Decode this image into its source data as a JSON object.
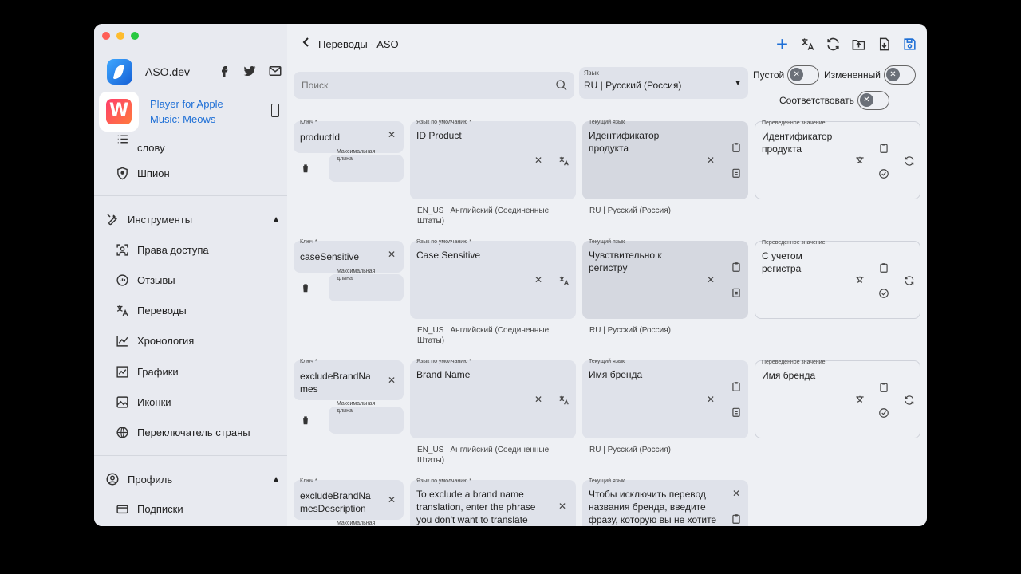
{
  "sidebar": {
    "brand": "ASO.dev",
    "app_title": "Player for Apple Music: Meows",
    "partial_item": "слову",
    "spy": "Шпион",
    "tools_section": "Инструменты",
    "tools_items": [
      "Права доступа",
      "Отзывы",
      "Переводы",
      "Хронология",
      "Графики",
      "Иконки",
      "Переключатель страны"
    ],
    "profile_section": "Профиль",
    "profile_items": [
      "Подписки"
    ]
  },
  "header": {
    "title": "Переводы - ASO"
  },
  "search": {
    "placeholder": "Поиск"
  },
  "language": {
    "label": "Язык",
    "value": "RU | Русский (Россия)"
  },
  "filters": {
    "empty": "Пустой",
    "changed": "Измененный",
    "match": "Соответствовать"
  },
  "labels": {
    "key": "Ключ *",
    "max_length": "Максимальная длина",
    "default_lang": "Язык по умолчанию *",
    "current_lang": "Текущий язык",
    "translated": "Переведенное значение",
    "default_locale": "EN_US | Английский (Соединенные Штаты)",
    "current_locale": "RU | Русский (Россия)"
  },
  "rows": [
    {
      "key": "productId",
      "default": "ID Product",
      "current": "Идентификатор продукта",
      "translated": "Идентификатор продукта"
    },
    {
      "key": "caseSensitive",
      "default": "Case Sensitive",
      "current": "Чувствительно к регистру",
      "translated": "С учетом регистра"
    },
    {
      "key": "excludeBrandNames",
      "default": "Brand Name",
      "current": "Имя бренда",
      "translated": "Имя бренда"
    },
    {
      "key": "excludeBrandNamesDescription",
      "default": "To exclude a brand name translation, enter the phrase you don't want to translate",
      "current": "Чтобы исключить перевод названия бренда, введите фразу, которую вы не хотите"
    }
  ]
}
